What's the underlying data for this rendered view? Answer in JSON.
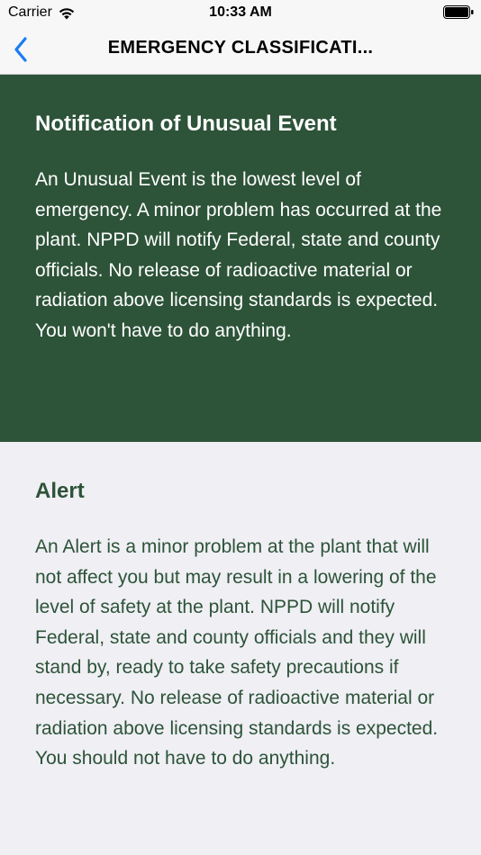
{
  "status_bar": {
    "carrier": "Carrier",
    "time": "10:33 AM"
  },
  "nav": {
    "title": "EMERGENCY CLASSIFICATI...",
    "back_icon": "chevron-left-icon",
    "accent_color": "#1a7cf5"
  },
  "sections": [
    {
      "title": "Notification of Unusual Event",
      "body": "An Unusual Event is the lowest level of emergency. A minor problem has occurred at the plant. NPPD will notify Federal, state and county officials. No release of radioactive material or radiation above licensing standards is expected. You won't have to do anything.",
      "background": "#2d5338",
      "text_color": "#ffffff"
    },
    {
      "title": "Alert",
      "body": "An Alert is a minor problem at the plant that will not affect you but may result in a lowering of the level of safety at the plant. NPPD will notify Federal, state and county officials and they will stand by, ready to take safety precautions if necessary. No release of radioactive material or radiation above licensing standards is expected. You should not have to do anything.",
      "background": "#efeff4",
      "text_color": "#2d5338"
    }
  ]
}
